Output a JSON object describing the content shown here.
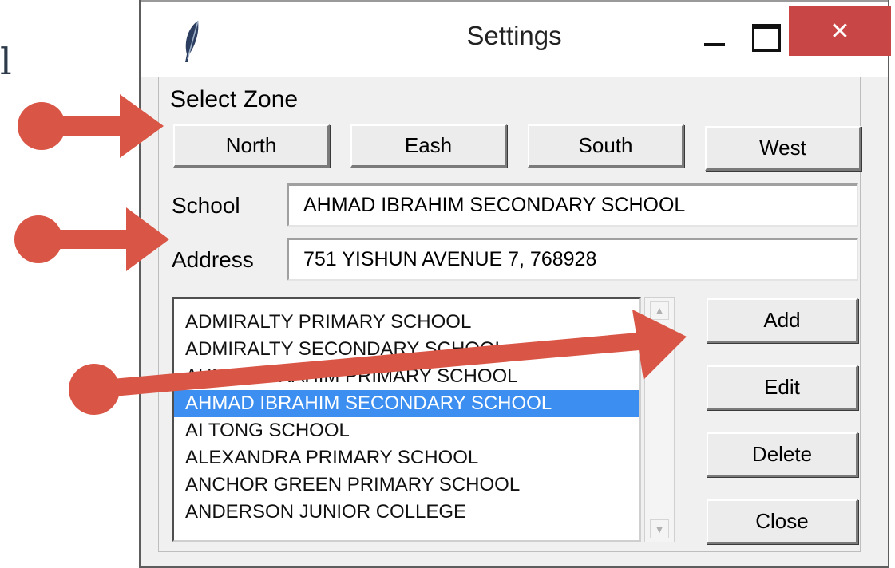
{
  "background": {
    "glyph": "l"
  },
  "window": {
    "title": "Settings",
    "close_glyph": "✕",
    "icons": {
      "app": "feather-icon",
      "minimize": "minimize-icon",
      "maximize": "maximize-icon",
      "close": "close-icon"
    }
  },
  "zone": {
    "label": "Select Zone",
    "buttons": [
      "North",
      "Eash",
      "South",
      "West"
    ]
  },
  "form": {
    "school_label": "School",
    "school_value": "AHMAD IBRAHIM SECONDARY SCHOOL",
    "address_label": "Address",
    "address_value": "751 YISHUN AVENUE 7, 768928"
  },
  "list": {
    "items": [
      "ADMIRALTY PRIMARY SCHOOL",
      "ADMIRALTY SECONDARY SCHOOL",
      "AHMAD IBRAHIM PRIMARY SCHOOL",
      "AHMAD IBRAHIM SECONDARY SCHOOL",
      "AI TONG SCHOOL",
      "ALEXANDRA PRIMARY SCHOOL",
      "ANCHOR GREEN PRIMARY SCHOOL",
      "ANDERSON JUNIOR COLLEGE"
    ],
    "selected_index": 3,
    "scroll_up_glyph": "▲",
    "scroll_down_glyph": "▼"
  },
  "actions": {
    "add": "Add",
    "edit": "Edit",
    "delete": "Delete",
    "close": "Close"
  },
  "colors": {
    "selection": "#3c8ff0",
    "close_button": "#c94646",
    "annotation_arrow": "#d95545"
  }
}
